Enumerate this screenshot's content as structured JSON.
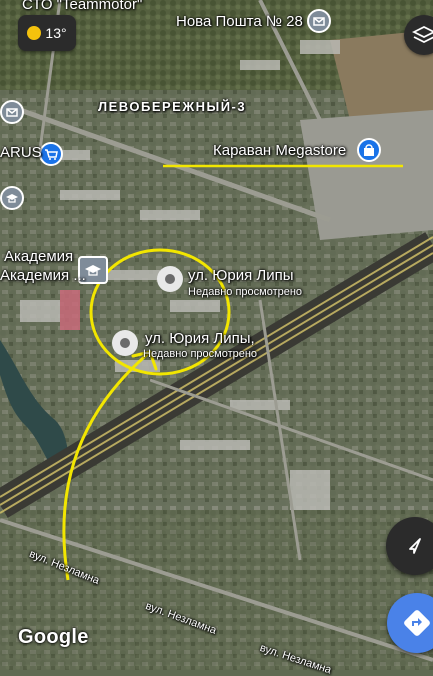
{
  "weather": {
    "temp": "13°",
    "icon": "sun-icon"
  },
  "labels": {
    "sto": "СТО \"Teammotor\"",
    "nova_poshta": "Нова Пошта № 28",
    "district": "ЛЕВОБЕРЕЖНЫЙ-3",
    "karavan": "Караван Megastore",
    "arus": "ARUS",
    "akademia_1": "Академия",
    "akademia_2": "Академия ...",
    "street_1": "ул. Юрия Липы",
    "street_1_sub": "Недавно просмотрено",
    "street_2": "ул. Юрия Липы,",
    "street_2_sub": "Недавно просмотрено",
    "vul_1": "вул. Незламна",
    "vul_2": "вул. Незламна",
    "vul_3": "вул. Незламна"
  },
  "branding": {
    "google": "Google"
  },
  "controls": {
    "layers_icon": "layers-icon",
    "compass_icon": "navigation-arrow-icon",
    "directions_icon": "directions-icon"
  },
  "colors": {
    "annotation": "#f2e600",
    "directions": "#4a82e8",
    "pin": "#e8e8e8",
    "poi_blue": "#1a73e8"
  }
}
